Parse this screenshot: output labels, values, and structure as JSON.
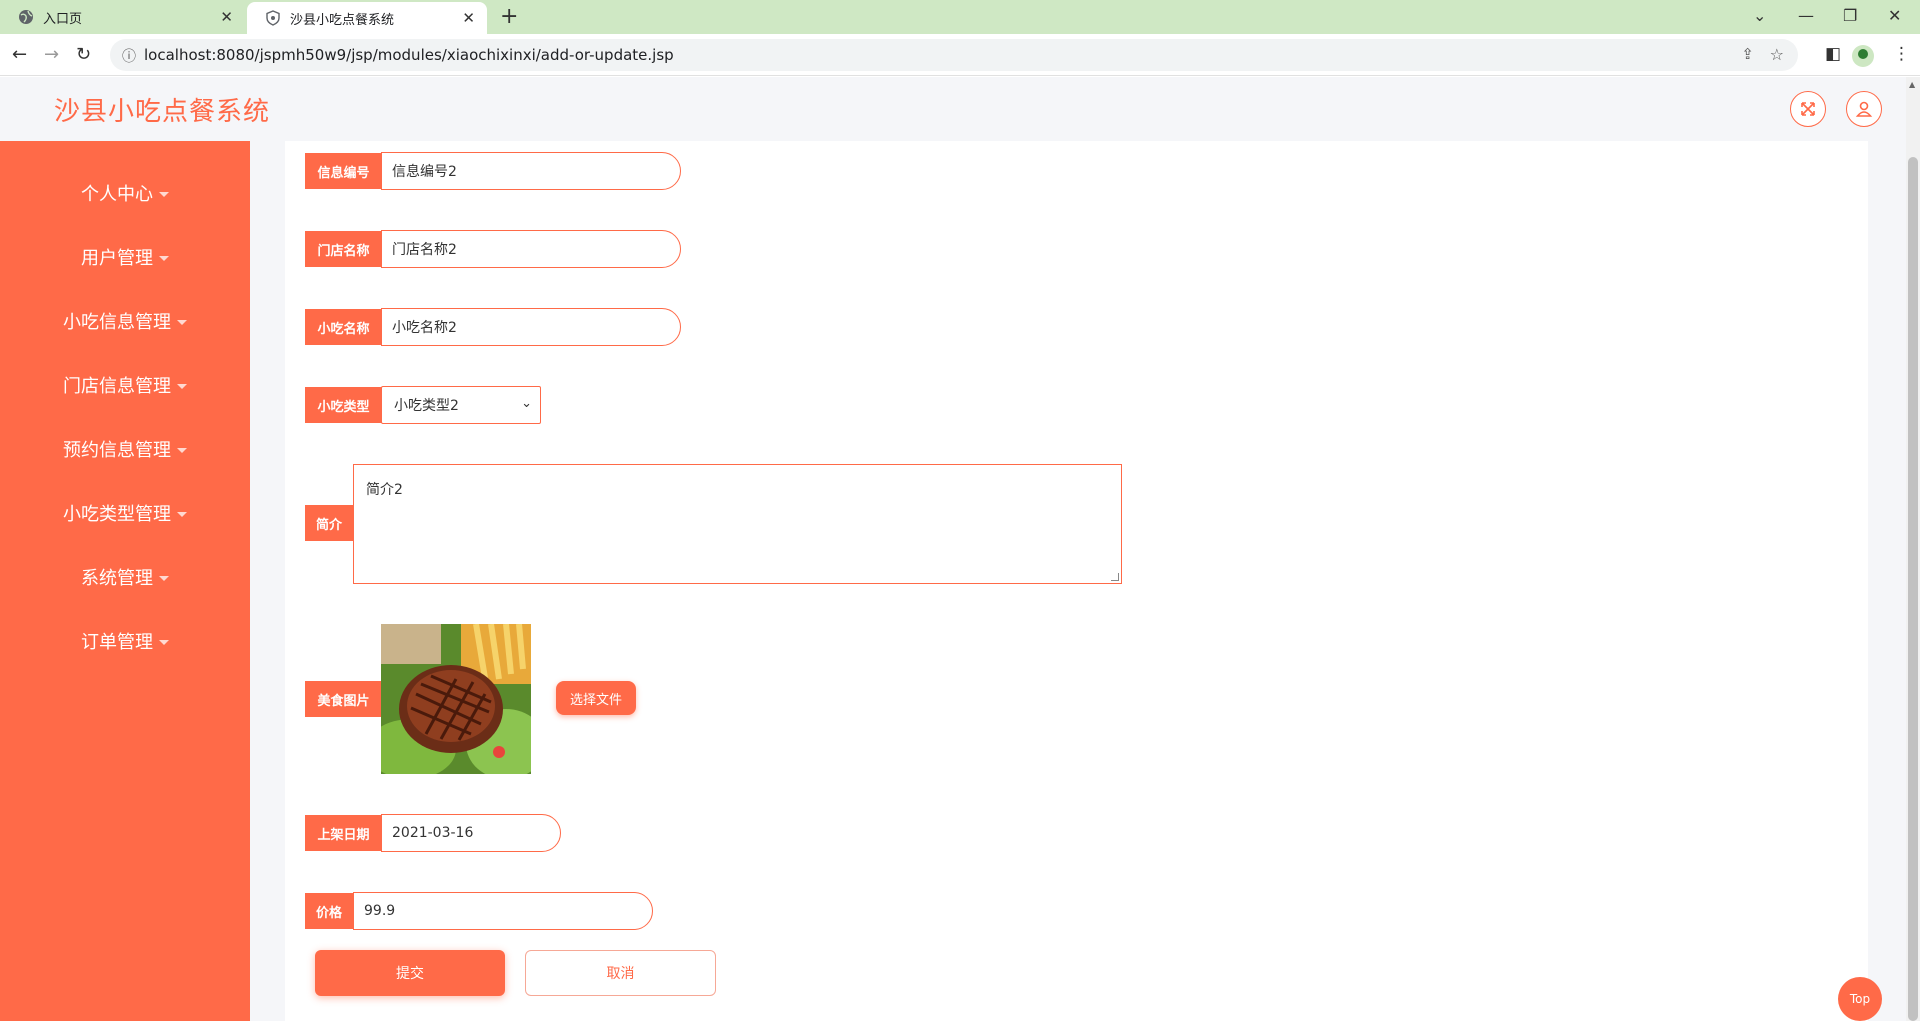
{
  "browser": {
    "tabs": [
      {
        "title": "入口页",
        "active": false
      },
      {
        "title": "沙县小吃点餐系统",
        "active": true
      }
    ],
    "url": "localhost:8080/jspmh50w9/jsp/modules/xiaochixinxi/add-or-update.jsp",
    "new_tab": "+",
    "tab_close": "✕"
  },
  "app": {
    "title": "沙县小吃点餐系统",
    "accent_color": "#ff6a48"
  },
  "sidebar": {
    "items": [
      {
        "label": "个人中心"
      },
      {
        "label": "用户管理"
      },
      {
        "label": "小吃信息管理"
      },
      {
        "label": "门店信息管理"
      },
      {
        "label": "预约信息管理"
      },
      {
        "label": "小吃类型管理"
      },
      {
        "label": "系统管理"
      },
      {
        "label": "订单管理"
      }
    ]
  },
  "form": {
    "info_no": {
      "label": "信息编号",
      "value": "信息编号2"
    },
    "store_name": {
      "label": "门店名称",
      "value": "门店名称2"
    },
    "snack_name": {
      "label": "小吃名称",
      "value": "小吃名称2"
    },
    "snack_type": {
      "label": "小吃类型",
      "value": "小吃类型2"
    },
    "intro": {
      "label": "简介",
      "value": "简介2"
    },
    "image": {
      "label": "美食图片",
      "button": "选择文件"
    },
    "date": {
      "label": "上架日期",
      "value": "2021-03-16"
    },
    "price": {
      "label": "价格",
      "value": "99.9"
    },
    "submit": "提交",
    "cancel": "取消"
  },
  "top_button": "Top",
  "icons": {
    "fullscreen": "fullscreen-icon",
    "user": "user-icon"
  }
}
